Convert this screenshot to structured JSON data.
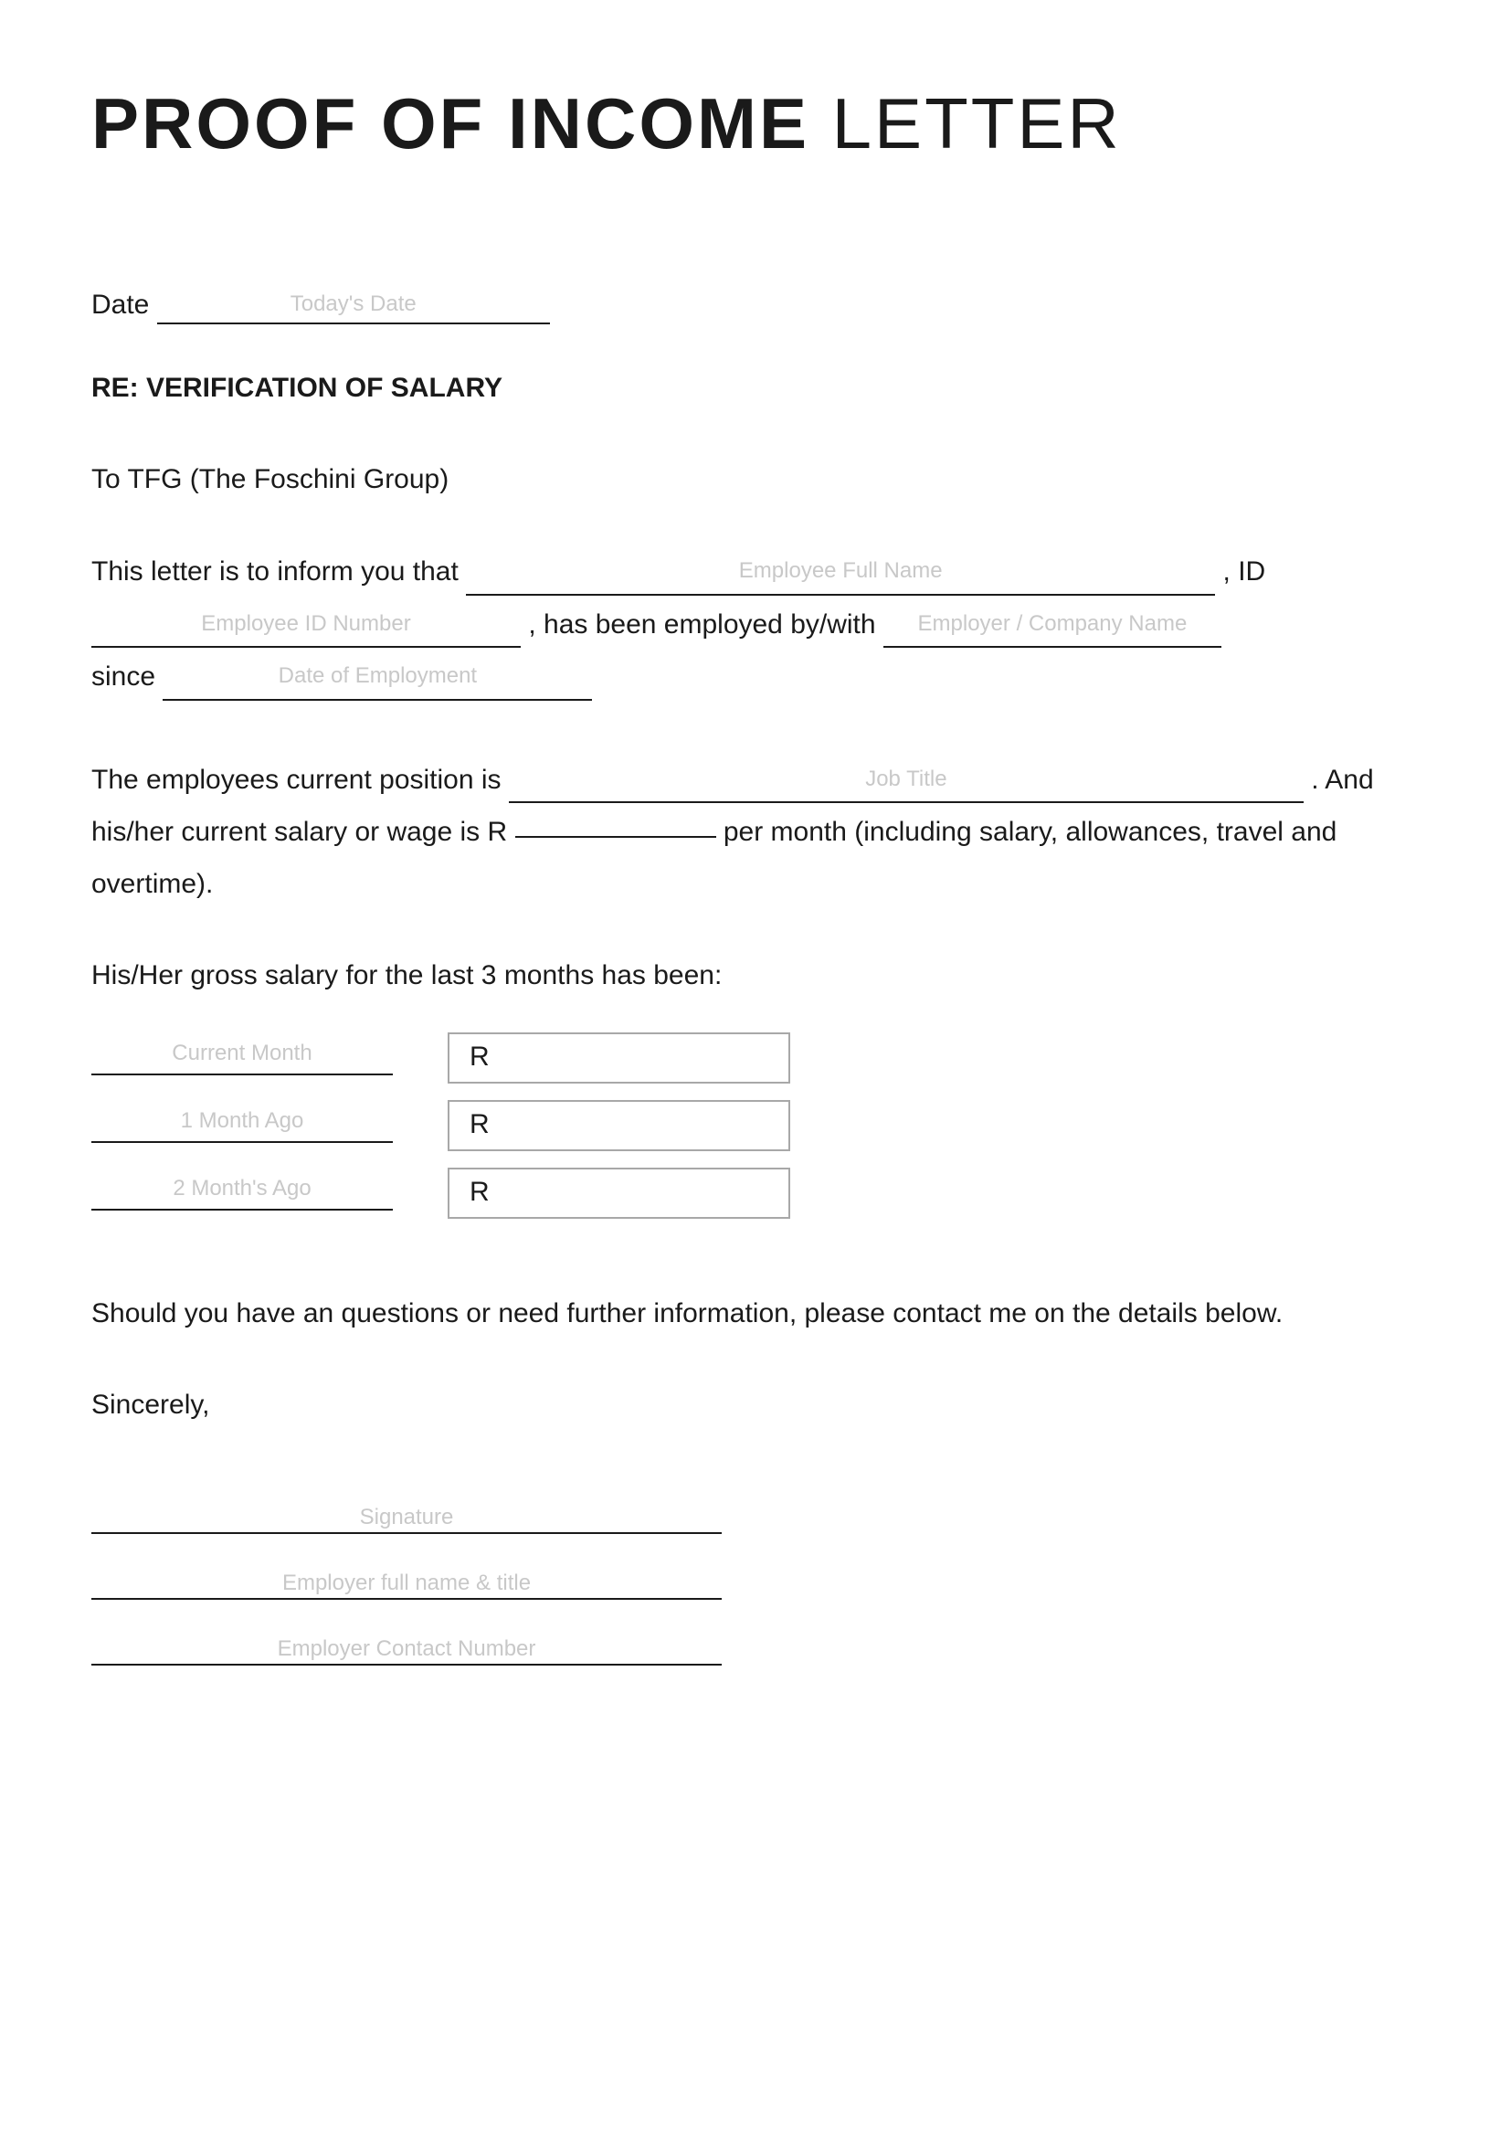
{
  "title_bold": "PROOF OF INCOME",
  "title_light": "LETTER",
  "date_label": "Date",
  "date_placeholder": "Today's Date",
  "subject": "RE: VERIFICATION OF SALARY",
  "addressee": "To TFG (The Foschini Group)",
  "para1": {
    "text1": "This letter is to inform you that",
    "ph_name": "Employee Full Name",
    "comma1": ",",
    "text2": "ID",
    "ph_id": "Employee ID Number",
    "text3": ", has been employed by/with",
    "ph_employer": "Employer / Company Name",
    "text4": "since",
    "ph_since": "Date of Employment"
  },
  "para2": {
    "text1": "The employees current position is",
    "ph_job": "Job Title",
    "period": ".",
    "text2": "And his/her current salary or wage is R",
    "text3": "per month (including salary, allowances, travel and overtime)."
  },
  "salary_intro": "His/Her gross salary for the last 3 months has been:",
  "salary_rows": {
    "r0": {
      "label": "Current Month",
      "currency": "R"
    },
    "r1": {
      "label": "1 Month Ago",
      "currency": "R"
    },
    "r2": {
      "label": "2 Month's Ago",
      "currency": "R"
    }
  },
  "closing": "Should you have an questions or need further information, please contact me on the details below.",
  "sincerely": "Sincerely,",
  "sig": {
    "signature": "Signature",
    "name_title": "Employer full name & title",
    "contact": "Employer Contact Number"
  }
}
